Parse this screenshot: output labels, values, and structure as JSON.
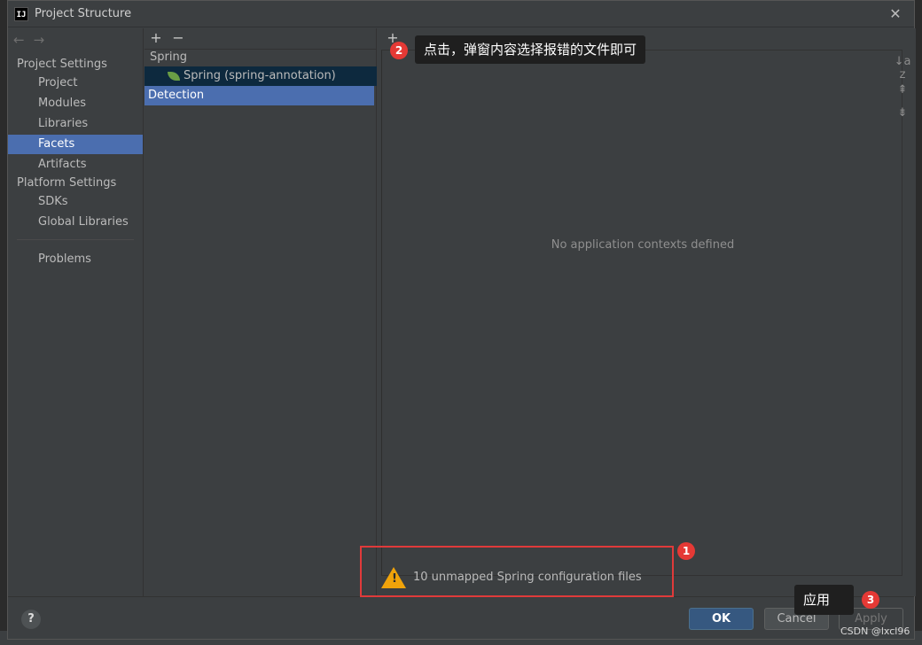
{
  "window": {
    "title": "Project Structure",
    "app_icon": "IJ"
  },
  "nav": {
    "back_icon": "←",
    "forward_icon": "→",
    "sections": [
      {
        "label": "Project Settings",
        "items": [
          "Project",
          "Modules",
          "Libraries",
          "Facets",
          "Artifacts"
        ]
      },
      {
        "label": "Platform Settings",
        "items": [
          "SDKs",
          "Global Libraries"
        ]
      }
    ],
    "problems": "Problems",
    "selected": "Facets"
  },
  "tree": {
    "add": "+",
    "remove": "−",
    "group": "Spring",
    "item": "Spring (spring-annotation)",
    "detection": "Detection"
  },
  "content": {
    "add": "+",
    "empty_message": "No application contexts defined",
    "side_tools": [
      "↓a z",
      "⇞",
      "⇟"
    ]
  },
  "warning": {
    "text": "10 unmapped Spring configuration files"
  },
  "buttons": {
    "help": "?",
    "ok": "OK",
    "cancel": "Cancel",
    "apply": "Apply"
  },
  "annotations": {
    "badge1": "1",
    "badge2": "2",
    "badge3": "3",
    "tooltip2": "点击，弹窗内容选择报错的文件即可",
    "tooltip3": "应用",
    "watermark": "CSDN @lxcl96"
  },
  "colors": {
    "selection": "#4b6eaf",
    "warning": "#f0a30a",
    "annotation": "#e53935"
  }
}
